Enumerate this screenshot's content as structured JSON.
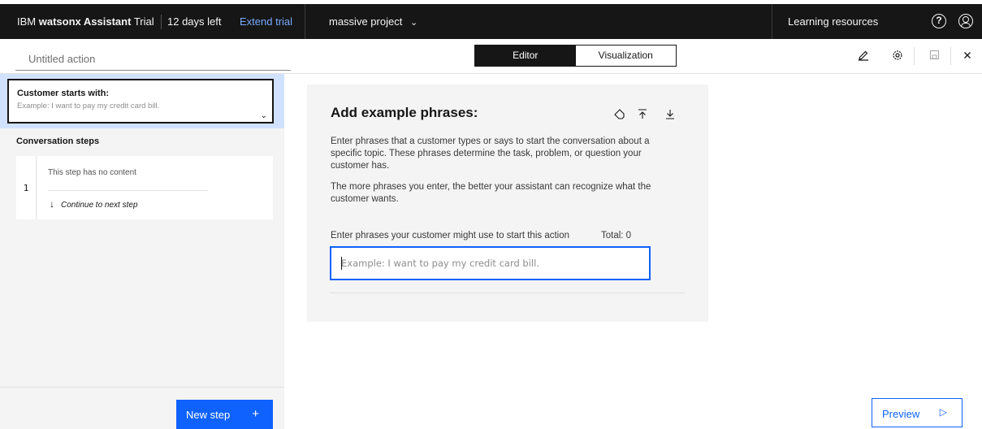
{
  "header": {
    "brand_company": "IBM",
    "brand_product": "watsonx Assistant",
    "brand_plan": "Trial",
    "days_left": "12 days left",
    "extend_trial": "Extend trial",
    "project": "massive project",
    "learning_resources": "Learning resources",
    "help_glyph": "?"
  },
  "toolbar": {
    "action_title_placeholder": "Untitled action",
    "tabs": [
      {
        "label": "Editor",
        "active": true
      },
      {
        "label": "Visualization",
        "active": false
      }
    ],
    "icons": [
      "edit-icon",
      "settings-icon",
      "save-icon",
      "close-icon"
    ]
  },
  "sidebar": {
    "starts_with_label": "Customer starts with:",
    "starts_with_example": "Example: I want to pay my credit card bill.",
    "conversation_steps_label": "Conversation steps",
    "steps": [
      {
        "number": "1",
        "content": "This step has no content",
        "next": "Continue to next step"
      }
    ],
    "new_step_label": "New step"
  },
  "main": {
    "title": "Add example phrases:",
    "description_1": "Enter phrases that a customer types or says to start the conversation about a specific topic. These phrases determine the task, problem, or question your customer has.",
    "description_2": "The more phrases you enter, the better your assistant can recognize what the customer wants.",
    "field_label": "Enter phrases your customer might use to start this action",
    "total_label": "Total: 0",
    "input_placeholder": "Example: I want to pay my credit card bill.",
    "icons": [
      "tag-icon",
      "upload-icon",
      "download-icon"
    ]
  },
  "preview_label": "Preview",
  "colors": {
    "header_bg": "#161616",
    "accent": "#0f62fe",
    "link": "#78a9ff",
    "panel_bg": "#f4f4f4",
    "selected_bg": "#d0e2ff"
  }
}
